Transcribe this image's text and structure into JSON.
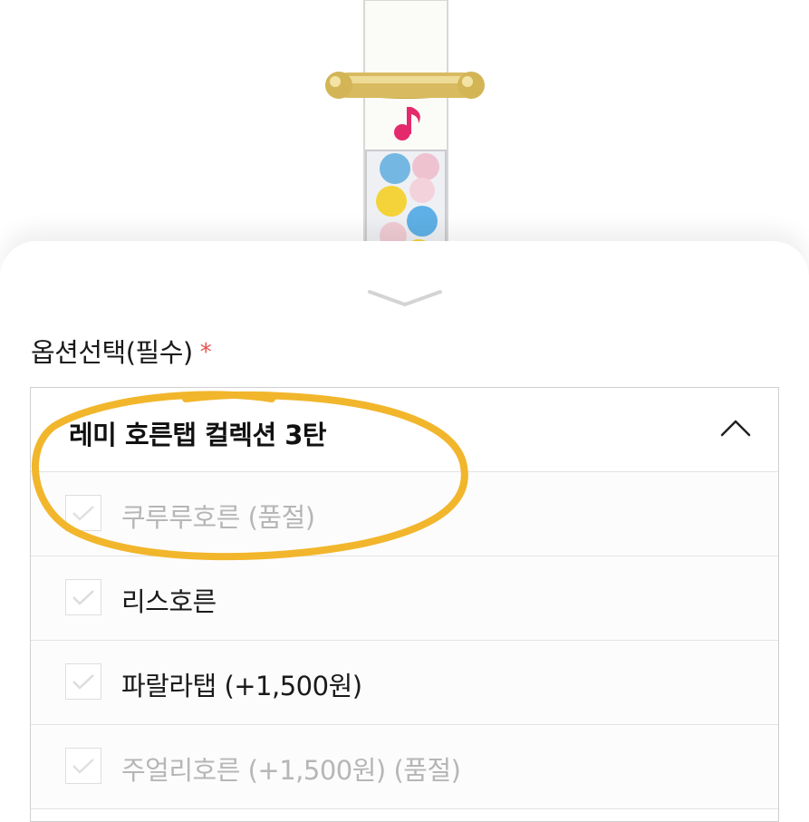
{
  "option_section": {
    "title": "옵션선택(필수)",
    "required_mark": "*",
    "required_color": "#e8534d"
  },
  "dropdown": {
    "selected_label": "레미 호른탭 컬렉션 3탄",
    "expanded": true,
    "options": [
      {
        "label": "쿠루루호른 (품절)",
        "status": "soldout"
      },
      {
        "label": "리스호른",
        "status": "available"
      },
      {
        "label": "파랄라탭 (+1,500원)",
        "status": "available"
      },
      {
        "label": "주얼리호른 (+1,500원) (품절)",
        "status": "soldout"
      }
    ]
  },
  "colors": {
    "highlight": "#f2b62c",
    "soldout_text": "#b6b6b6",
    "text": "#1a1a1a"
  }
}
